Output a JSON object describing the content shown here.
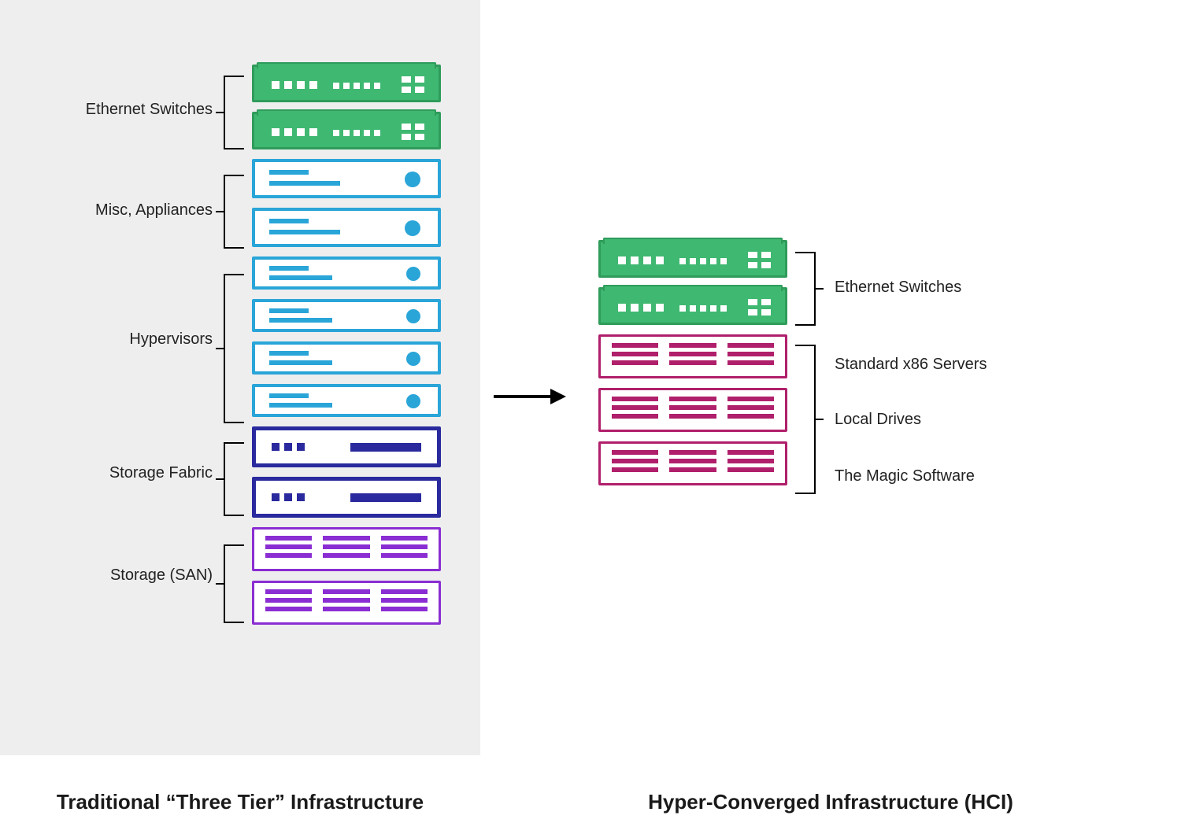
{
  "captions": {
    "left": "Traditional “Three Tier” Infrastructure",
    "right": "Hyper-Converged Infrastructure (HCI)"
  },
  "left_labels": {
    "ethernet": "Ethernet Switches",
    "appliances": "Misc, Appliances",
    "hypervisors": "Hypervisors",
    "fabric": "Storage Fabric",
    "san": "Storage (SAN)"
  },
  "right_labels": {
    "ethernet": "Ethernet Switches",
    "servers": "Standard x86 Servers",
    "drives": "Local Drives",
    "software": "The Magic Software"
  },
  "colors": {
    "switch_green": "#3fb871",
    "appliance_blue": "#2aa5d8",
    "fabric_navy": "#2a2a9e",
    "san_purple": "#8a2dd2",
    "hci_magenta": "#b01f6b",
    "left_bg": "#eeeeee"
  },
  "left_stack": [
    {
      "type": "switch",
      "group": "ethernet"
    },
    {
      "type": "switch",
      "group": "ethernet"
    },
    {
      "type": "server-blue",
      "group": "appliances"
    },
    {
      "type": "server-blue",
      "group": "appliances"
    },
    {
      "type": "server-blue-thin",
      "group": "hypervisors"
    },
    {
      "type": "server-blue-thin",
      "group": "hypervisors"
    },
    {
      "type": "server-blue-thin",
      "group": "hypervisors"
    },
    {
      "type": "server-blue-thin",
      "group": "hypervisors"
    },
    {
      "type": "fabric",
      "group": "fabric"
    },
    {
      "type": "fabric",
      "group": "fabric"
    },
    {
      "type": "san",
      "group": "san"
    },
    {
      "type": "san",
      "group": "san"
    }
  ],
  "right_stack": [
    {
      "type": "switch",
      "group": "ethernet"
    },
    {
      "type": "switch",
      "group": "ethernet"
    },
    {
      "type": "hci",
      "group": "servers"
    },
    {
      "type": "hci",
      "group": "servers"
    },
    {
      "type": "hci",
      "group": "servers"
    }
  ]
}
